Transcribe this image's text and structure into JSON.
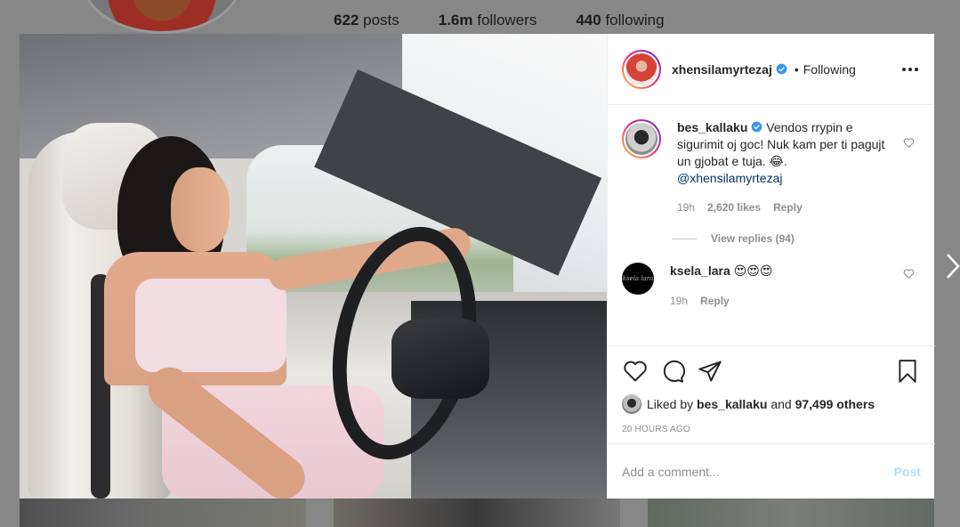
{
  "profile_stats": {
    "posts_count": "622",
    "posts_label": "posts",
    "followers_count": "1.6m",
    "followers_label": "followers",
    "following_count": "440",
    "following_label": "following"
  },
  "post": {
    "owner_username": "xhensilamyrtezaj",
    "follow_status": "Following",
    "dot": "•"
  },
  "comments": [
    {
      "username": "bes_kallaku",
      "text": "Vendos rrypin e sigurimit oj goc! Nuk kam per ti pagujt un gjobat e tuja. 😂.",
      "mention": "@xhensilamyrtezaj",
      "time": "19h",
      "likes": "2,620 likes",
      "reply": "Reply",
      "view_replies": "View replies (94)"
    },
    {
      "username": "ksela_lara",
      "text": "😍😍😍",
      "time": "19h",
      "reply": "Reply",
      "avatar_text": "ksela lara"
    }
  ],
  "likes": {
    "liked_by_prefix": "Liked by",
    "liked_by_user": "bes_kallaku",
    "and_text": "and",
    "others": "97,499 others"
  },
  "timestamp": "20 HOURS AGO",
  "add_comment": {
    "placeholder": "Add a comment...",
    "post_label": "Post"
  },
  "icons": [
    "heart-icon",
    "comment-icon",
    "share-icon",
    "bookmark-icon",
    "more-icon",
    "verified-icon",
    "chevron-right-icon"
  ],
  "colors": {
    "verified": "#3897f0",
    "link": "#00376b",
    "muted": "#8e8e8e",
    "post_disabled": "#b2dffc"
  }
}
